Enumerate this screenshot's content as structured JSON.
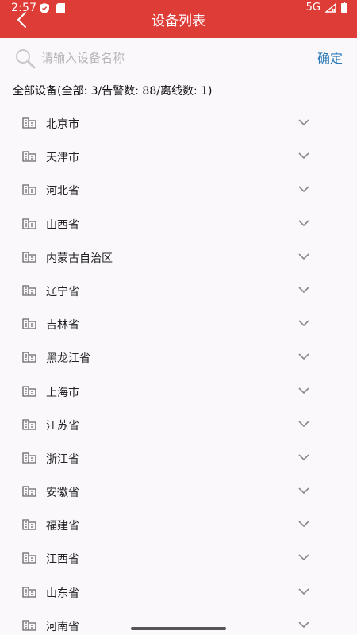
{
  "status_bar": {
    "time": "2:57",
    "network": "5G"
  },
  "header": {
    "title": "设备列表"
  },
  "search": {
    "placeholder": "请输入设备名称",
    "confirm_label": "确定"
  },
  "summary": {
    "text": "全部设备(全部: 3/告警数: 88/离线数: 1)"
  },
  "list": {
    "items": [
      {
        "label": "北京市"
      },
      {
        "label": "天津市"
      },
      {
        "label": "河北省"
      },
      {
        "label": "山西省"
      },
      {
        "label": "内蒙古自治区"
      },
      {
        "label": "辽宁省"
      },
      {
        "label": "吉林省"
      },
      {
        "label": "黑龙江省"
      },
      {
        "label": "上海市"
      },
      {
        "label": "江苏省"
      },
      {
        "label": "浙江省"
      },
      {
        "label": "安徽省"
      },
      {
        "label": "福建省"
      },
      {
        "label": "江西省"
      },
      {
        "label": "山东省"
      },
      {
        "label": "河南省"
      }
    ]
  },
  "colors": {
    "header_bg": "#de3d37",
    "accent": "#2a79b9",
    "page_bg": "#fbf8fc"
  },
  "icons": {
    "back": "chevron-left-icon",
    "search": "search-icon",
    "item": "building-icon",
    "expand": "chevron-down-icon"
  }
}
